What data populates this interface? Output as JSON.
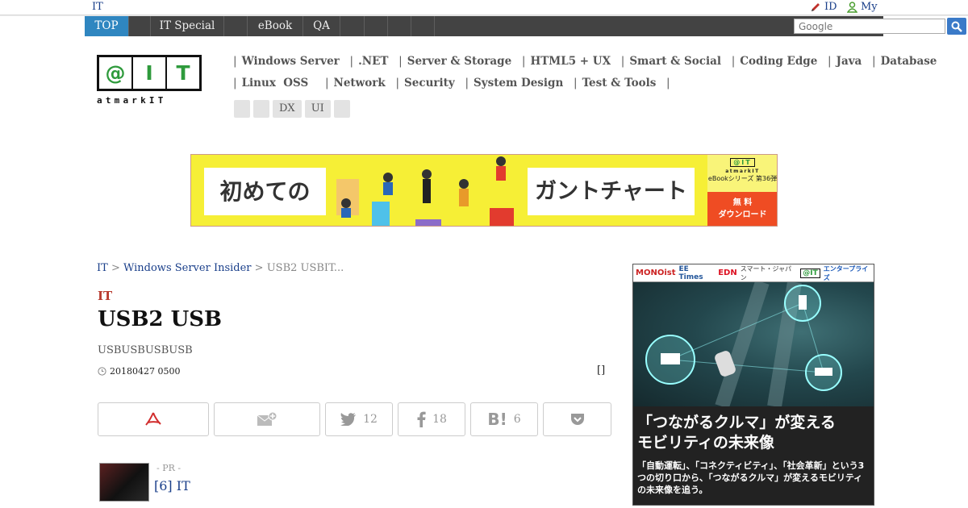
{
  "top_strip": {
    "site_label": "IT",
    "id_label": "ID",
    "my_label": "My"
  },
  "nav": {
    "items": [
      "TOP",
      "",
      "IT Special",
      "",
      "eBook",
      "QA",
      "",
      "",
      "",
      ""
    ],
    "search_placeholder": "Google"
  },
  "logo": {
    "mark": [
      "@",
      "I",
      "T"
    ],
    "text": "atmarkIT"
  },
  "categories": {
    "row1": [
      "Windows Server",
      ".NET",
      "Server & Storage",
      "HTML5 + UX",
      "Smart & Social",
      "Coding Edge",
      "Java",
      "Database"
    ],
    "row2": [
      "Linux  OSS",
      "Network",
      "Security",
      "System Design",
      "Test & Tools"
    ],
    "tags": [
      "",
      "",
      "DX",
      "UI",
      ""
    ]
  },
  "banner": {
    "left_text": "初めての",
    "right_text": "ガントチャート",
    "series_logo": "@IT",
    "series_wordmark": "atmarkIT",
    "series_text": "eBookシリーズ 第36弾",
    "free_line1": "無 料",
    "free_line2": "ダウンロード"
  },
  "breadcrumb": {
    "home": "IT",
    "sep": ">",
    "section": "Windows Server Insider",
    "current": "USB2 USBIT..."
  },
  "article": {
    "label": "IT",
    "title": "USB2 USB",
    "subtitle": "USBUSBUSBUSB",
    "date": "20180427 0500",
    "bracket": "[]"
  },
  "share": {
    "twitter_count": "12",
    "facebook_count": "18",
    "hatena_count": "6"
  },
  "pr": {
    "label": "- PR -",
    "link": "[6] IT"
  },
  "ad": {
    "brands": [
      "MONOist",
      "EE Times",
      "EDN",
      "スマート・ジャパン",
      "@IT",
      "エンタープライズ"
    ],
    "headline1": "「つながるクルマ」が変える",
    "headline2": "モビリティの未来像",
    "body": "「自動運転」、「コネクティビティ」、「社会革新」という3つの切り口から、「つながるクルマ」が変えるモビリティの未来像を追う。"
  },
  "colors": {
    "nav_bg": "#434343",
    "nav_active": "#2f86c0",
    "accent_red": "#b83a2e",
    "link": "#1a3f8a",
    "banner_yellow": "#f6ef36"
  }
}
